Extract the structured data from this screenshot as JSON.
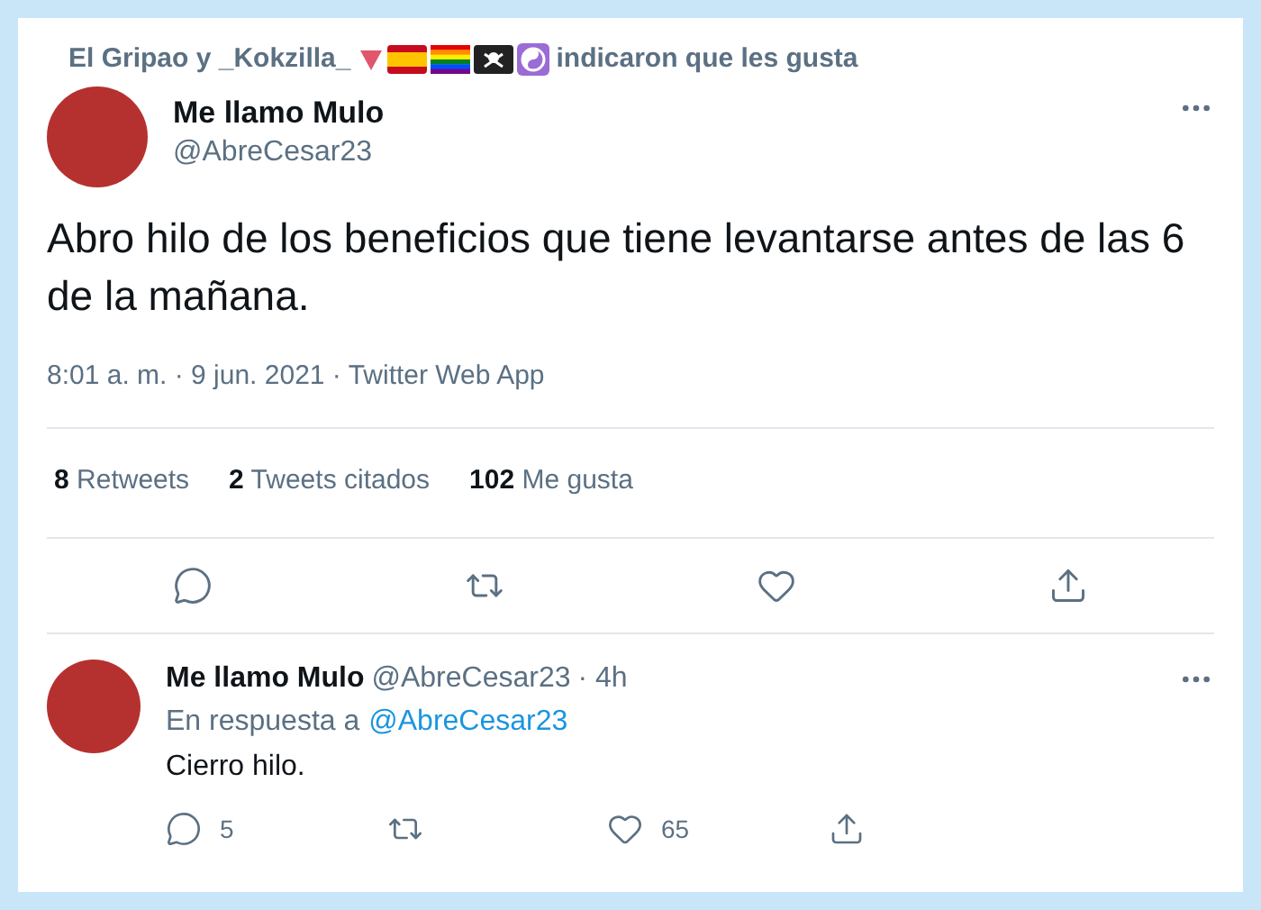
{
  "social_context": {
    "names": "El Gripao y _Kokzilla_",
    "suffix": "indicaron que les gusta"
  },
  "tweet": {
    "name": "Me llamo Mulo",
    "handle": "@AbreCesar23",
    "text": "Abro hilo de los beneficios que tiene levantarse antes de las 6 de la mañana.",
    "timestamp": "8:01 a. m. · 9 jun. 2021 · Twitter Web App",
    "stats": [
      {
        "count": "8",
        "label": "Retweets"
      },
      {
        "count": "2",
        "label": "Tweets citados"
      },
      {
        "count": "102",
        "label": "Me gusta"
      }
    ]
  },
  "reply": {
    "name": "Me llamo Mulo",
    "handle": "@AbreCesar23",
    "time": "· 4h",
    "reply_prefix": "En respuesta a",
    "reply_to": "@AbreCesar23",
    "text": "Cierro hilo.",
    "actions": [
      {
        "kind": "reply",
        "count": "5"
      },
      {
        "kind": "retweet"
      },
      {
        "kind": "like",
        "count": "65"
      },
      {
        "kind": "share"
      }
    ]
  }
}
